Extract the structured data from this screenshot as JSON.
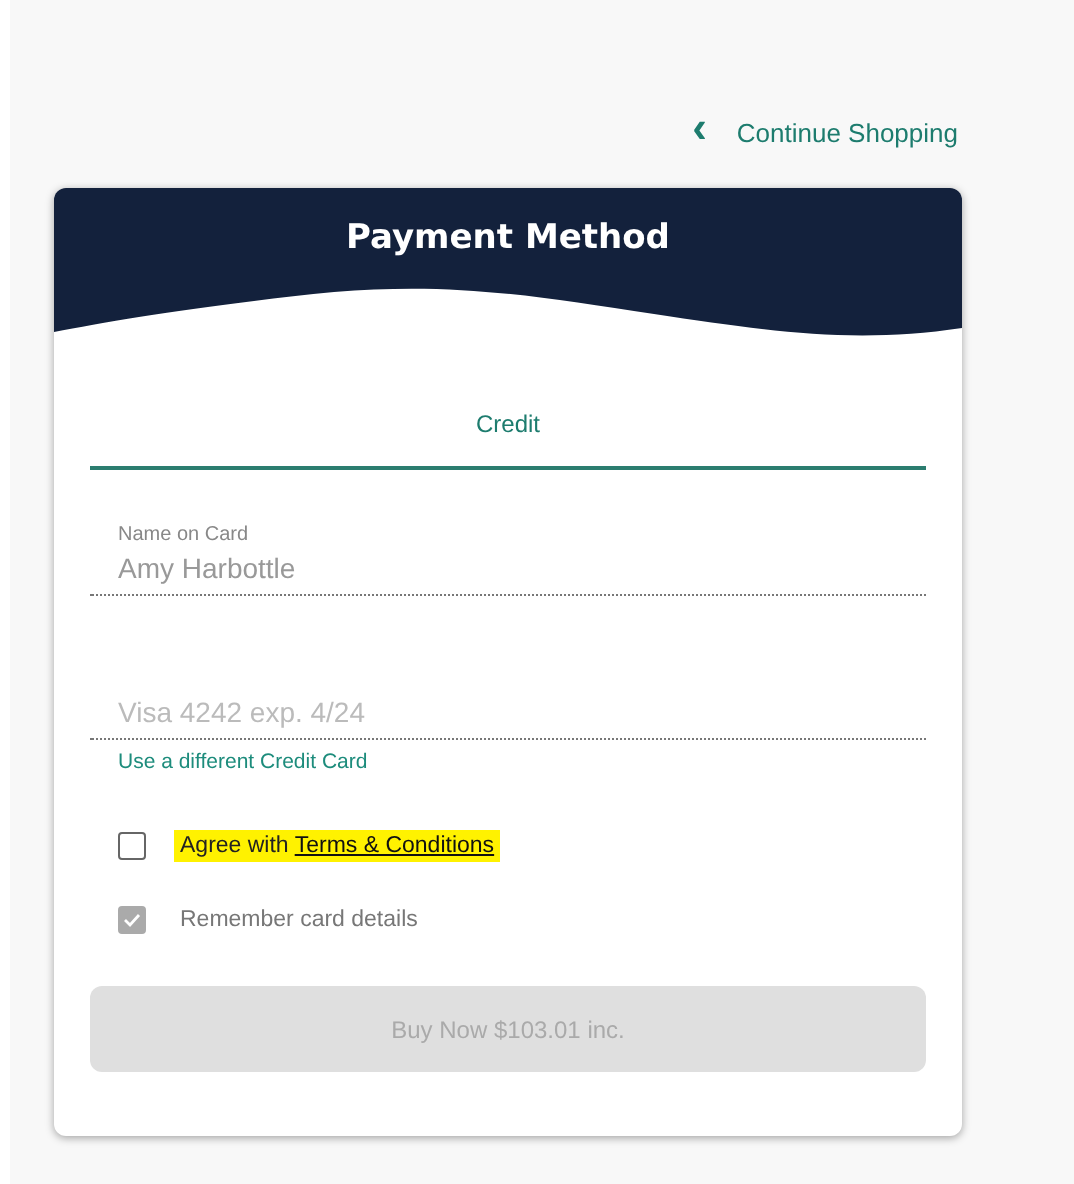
{
  "back_link": {
    "icon": "‹",
    "label": "Continue Shopping"
  },
  "card": {
    "title": "Payment Method"
  },
  "tabs": [
    {
      "label": "Credit",
      "selected": true
    }
  ],
  "fields": [
    {
      "label": "Name on Card",
      "value": "Amy Harbottle"
    },
    {
      "placeholder": "Visa 4242 exp. 4/24"
    }
  ],
  "card_link": "Use a different Credit Card",
  "checkboxes": [
    {
      "text": "Agree with",
      "link": "Terms & Conditions",
      "checked": false,
      "disabled": false,
      "highlighted": true
    },
    {
      "text": "Remember card details",
      "checked": true,
      "disabled": true,
      "highlighted": false
    }
  ],
  "buy_button": {
    "label": "Buy Now $103.01 inc.",
    "disabled": true
  }
}
